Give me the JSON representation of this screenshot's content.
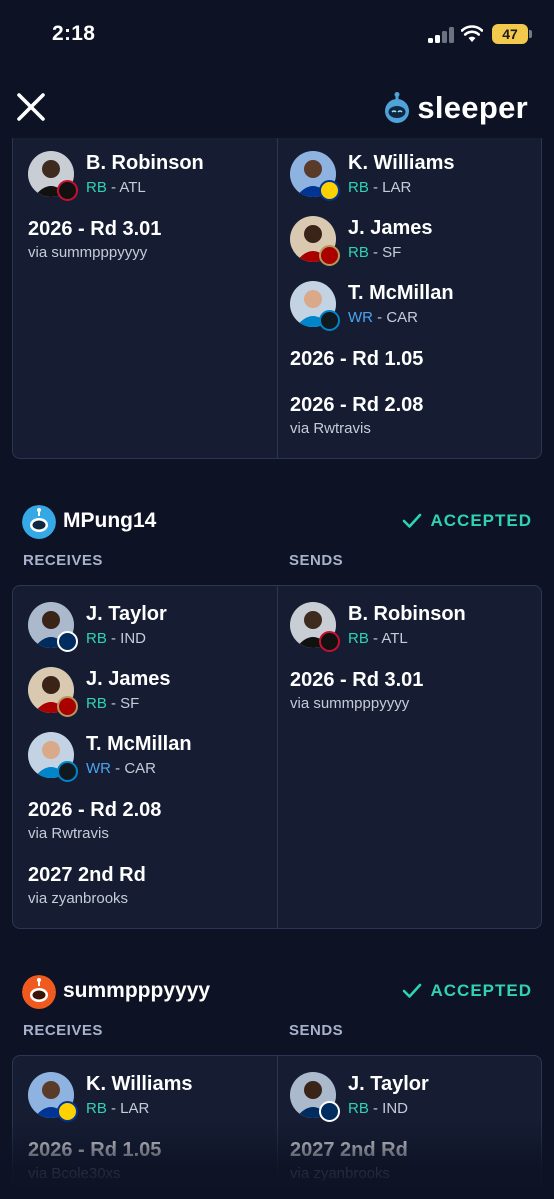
{
  "status_bar": {
    "time": "2:18",
    "battery": "47"
  },
  "header": {
    "logo_text": "sleeper"
  },
  "colors": {
    "accent": "#2fd3b4",
    "rb": "#2fd3b4",
    "wr": "#4aa3f0",
    "background": "#0d1224"
  },
  "trade_top": {
    "left": {
      "players": [
        {
          "name": "B. Robinson",
          "pos": "RB",
          "team": " - ATL"
        }
      ],
      "picks": [
        {
          "title": "2026 - Rd 3.01",
          "via": "via summpppyyyy"
        }
      ]
    },
    "right": {
      "players": [
        {
          "name": "K. Williams",
          "pos": "RB",
          "team": " - LAR"
        },
        {
          "name": "J. James",
          "pos": "RB",
          "team": " - SF"
        },
        {
          "name": "T. McMillan",
          "pos": "WR",
          "team": " - CAR"
        }
      ],
      "picks": [
        {
          "title": "2026 - Rd 1.05",
          "via": ""
        },
        {
          "title": "2026 - Rd 2.08",
          "via": "via Rwtravis"
        }
      ]
    }
  },
  "trade_mpung": {
    "team": "MPung14",
    "status": "ACCEPTED",
    "receives_label": "RECEIVES",
    "sends_label": "SENDS",
    "left": {
      "players": [
        {
          "name": "J. Taylor",
          "pos": "RB",
          "team": " - IND"
        },
        {
          "name": "J. James",
          "pos": "RB",
          "team": " - SF"
        },
        {
          "name": "T. McMillan",
          "pos": "WR",
          "team": " - CAR"
        }
      ],
      "picks": [
        {
          "title": "2026 - Rd 2.08",
          "via": "via Rwtravis"
        },
        {
          "title": "2027 2nd Rd",
          "via": "via zyanbrooks"
        }
      ]
    },
    "right": {
      "players": [
        {
          "name": "B. Robinson",
          "pos": "RB",
          "team": " - ATL"
        }
      ],
      "picks": [
        {
          "title": "2026 - Rd 3.01",
          "via": "via summpppyyyy"
        }
      ]
    }
  },
  "trade_summ": {
    "team": "summpppyyyy",
    "status": "ACCEPTED",
    "receives_label": "RECEIVES",
    "sends_label": "SENDS",
    "left": {
      "players": [
        {
          "name": "K. Williams",
          "pos": "RB",
          "team": " - LAR"
        }
      ],
      "picks": [
        {
          "title": "2026 - Rd 1.05",
          "via": "via Bcole30xs"
        }
      ]
    },
    "right": {
      "players": [
        {
          "name": "J. Taylor",
          "pos": "RB",
          "team": " - IND"
        }
      ],
      "picks": [
        {
          "title": "2027 2nd Rd",
          "via": "via zyanbrooks"
        }
      ]
    }
  }
}
